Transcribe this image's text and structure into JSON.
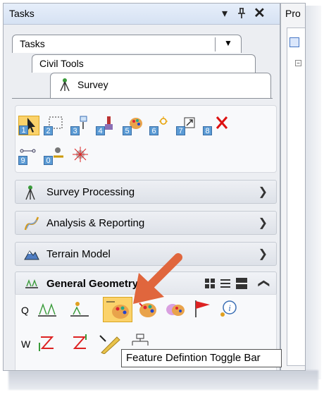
{
  "panel": {
    "title": "Tasks",
    "controls": {
      "menu": "▾",
      "pin": "Ҹ",
      "close": "✕"
    }
  },
  "right_panel": {
    "title": "Pro"
  },
  "tabs": {
    "tasks": "Tasks",
    "civil_tools": "Civil Tools",
    "survey": "Survey"
  },
  "toolbox": {
    "numbers": [
      "1",
      "2",
      "3",
      "4",
      "5",
      "6",
      "7",
      "8",
      "9",
      "0"
    ]
  },
  "sections": [
    {
      "label": "Survey Processing"
    },
    {
      "label": "Analysis & Reporting"
    },
    {
      "label": "Terrain Model"
    },
    {
      "label": "General Geometry"
    }
  ],
  "rows": {
    "q": "Q",
    "w": "W"
  },
  "tooltip": "Feature Defintion Toggle Bar",
  "colors": {
    "accent": "#5b9bd5",
    "arrow": "#e0663d",
    "titlebar": "#d6e2f3"
  }
}
